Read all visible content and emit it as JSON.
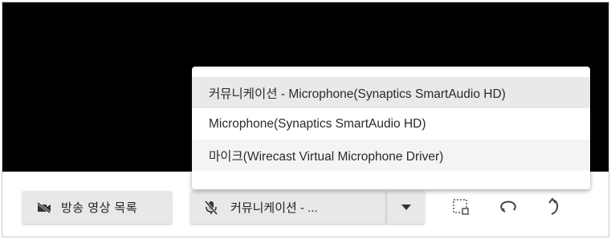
{
  "toolbar": {
    "broadcast_button_label": "방송 영상 목록",
    "mic_selected": "커뮤니케이션 - ..."
  },
  "mic_dropdown": {
    "options": [
      "커뮤니케이션 - Microphone(Synaptics SmartAudio HD)",
      "Microphone(Synaptics SmartAudio HD)",
      "마이크(Wirecast Virtual Microphone Driver)"
    ],
    "highlighted_index": 0
  },
  "icons": {
    "broadcast": "video-off-icon",
    "mic": "mic-off-icon",
    "arrow": "caret-down-icon",
    "select": "selection-box-icon",
    "loop": "loop-arrow-icon",
    "undo": "undo-icon"
  }
}
